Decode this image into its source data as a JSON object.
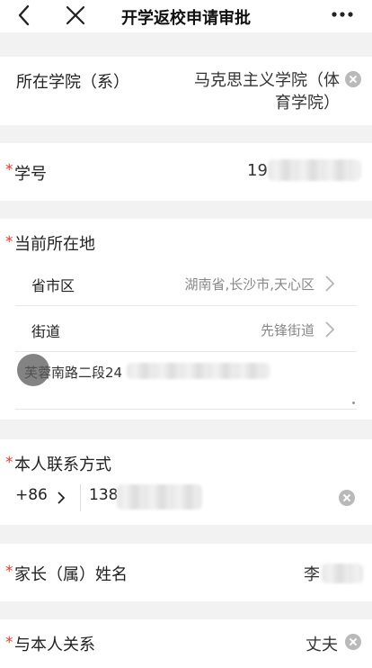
{
  "header": {
    "title": "开学返校申请审批"
  },
  "college": {
    "label": "所在学院（系）",
    "value_line1": "马克思主义学院（体",
    "value_line2": "育学院）"
  },
  "student_id": {
    "label": "学号",
    "value_visible": "19"
  },
  "location": {
    "label": "当前所在地",
    "region_label": "省市区",
    "region_value": "湖南省,长沙市,天心区",
    "street_label": "街道",
    "street_value": "先锋街道",
    "address_visible": "芙蓉南路二段24"
  },
  "contact": {
    "label": "本人联系方式",
    "country_code": "+86",
    "phone_visible": "138"
  },
  "parent_name": {
    "label": "家长（属）姓名",
    "value_visible": "李"
  },
  "relationship": {
    "label": "与本人关系",
    "value": "丈夫"
  },
  "required_mark": "*",
  "colors": {
    "required": "#e03b2f",
    "background": "#f2f2f2",
    "card": "#ffffff"
  }
}
